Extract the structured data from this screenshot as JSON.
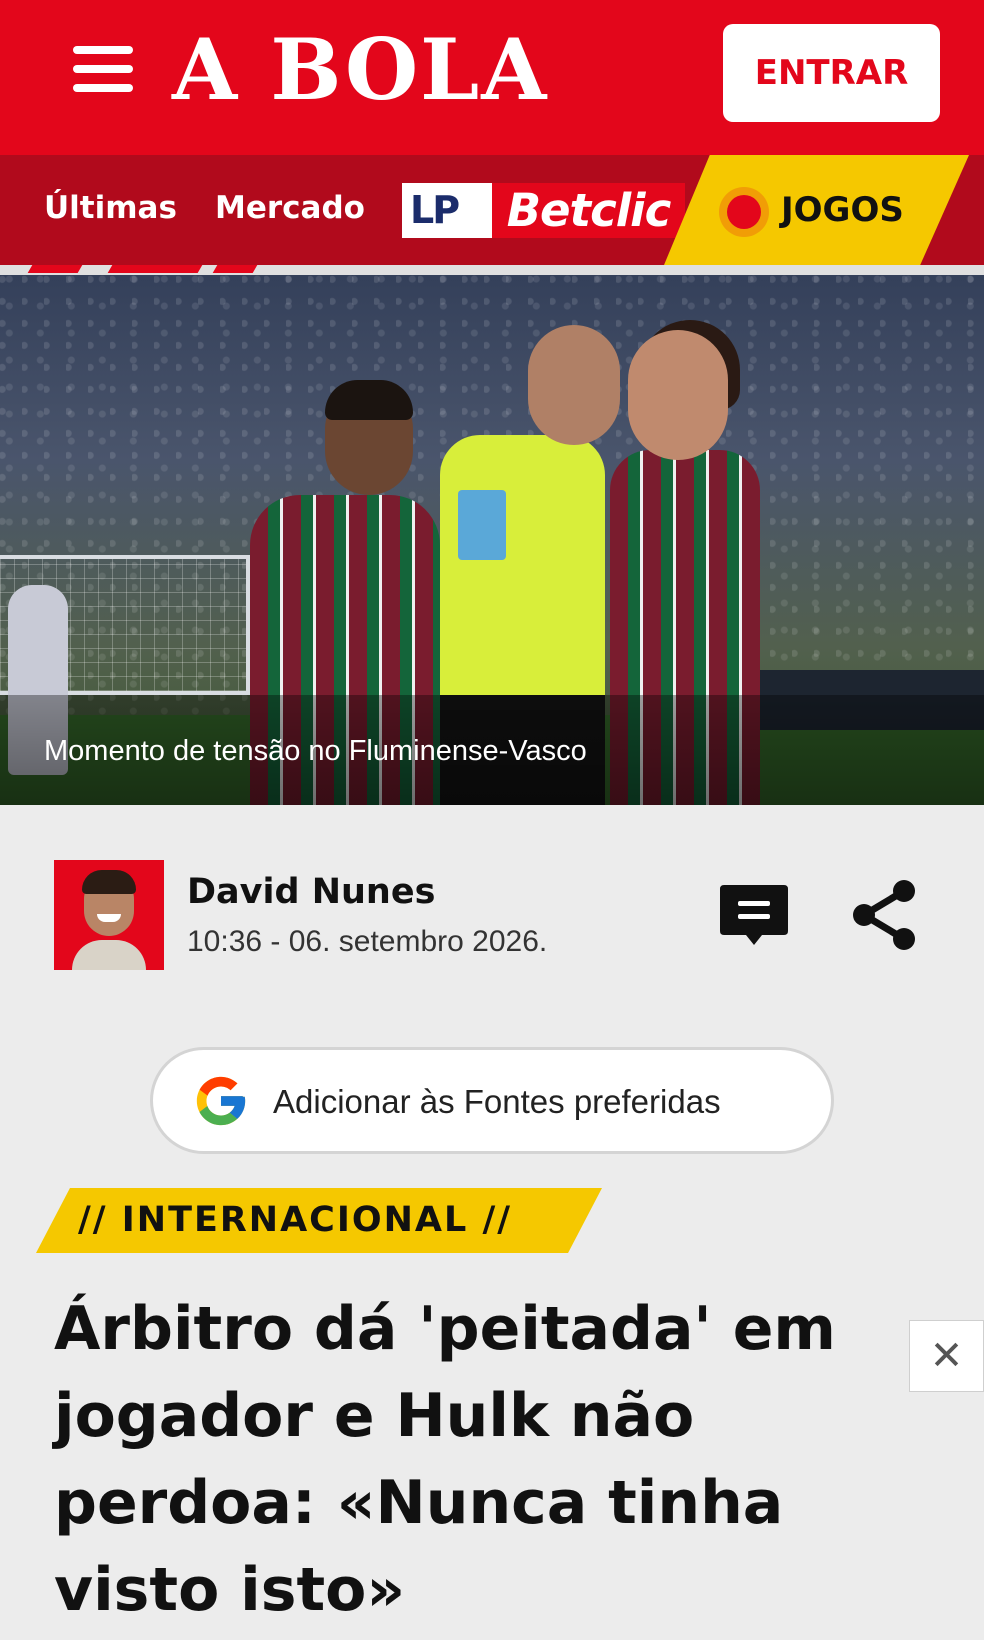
{
  "header": {
    "logo_text": "A BOLA",
    "login_label": "ENTRAR",
    "menu_icon": "hamburger-menu-icon",
    "brand_color": "#e3061b"
  },
  "nav": {
    "items": [
      {
        "label": "Últimas"
      },
      {
        "label": "Mercado"
      }
    ],
    "sponsor": {
      "lp": "LP",
      "brand": "Betclic"
    },
    "live": {
      "label": "JOGOS",
      "icon": "live-dot-icon"
    }
  },
  "hero": {
    "caption": "Momento de tensão no Fluminense-Vasco"
  },
  "article": {
    "author": "David Nunes",
    "date": "10:36 - 06. setembro 2026.",
    "comment_icon": "comment-icon",
    "share_icon": "share-icon",
    "preferred_sources_label": "Adicionar às Fontes preferidas",
    "category": "// INTERNACIONAL //",
    "headline": "Árbitro dá 'peitada' em jogador e Hulk não perdoa: «Nunca tinha visto isto»"
  },
  "ad": {
    "close_label": "✕"
  }
}
